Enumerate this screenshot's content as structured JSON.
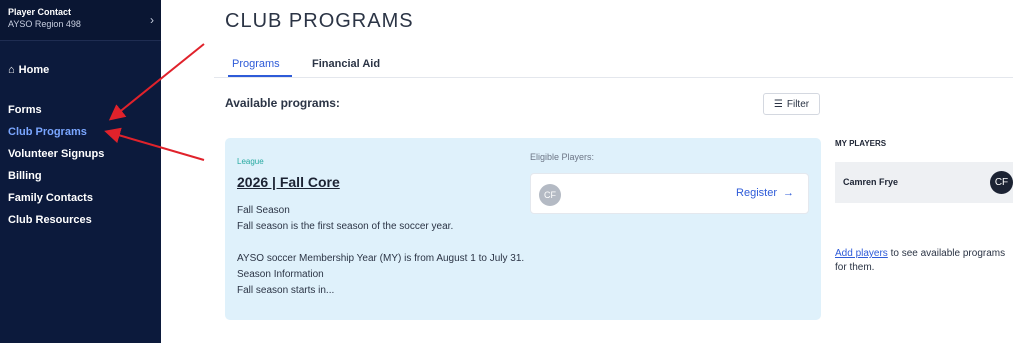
{
  "sidebar": {
    "org_label": "Player Contact",
    "org_region": "AYSO Region 498",
    "home_label": "Home",
    "items": [
      {
        "label": "Forms"
      },
      {
        "label": "Club Programs"
      },
      {
        "label": "Volunteer Signups"
      },
      {
        "label": "Billing"
      },
      {
        "label": "Family Contacts"
      },
      {
        "label": "Club Resources"
      }
    ],
    "active_index": 1
  },
  "main": {
    "title": "CLUB PROGRAMS",
    "tabs": [
      {
        "label": "Programs",
        "active": true
      },
      {
        "label": "Financial Aid",
        "active": false
      }
    ],
    "available_label": "Available programs:",
    "filter_label": "Filter"
  },
  "program": {
    "kind": "League",
    "name": "2026 | Fall Core",
    "description": "Fall Season\nFall season is the first season of the soccer year.\n\nAYSO soccer Membership Year (MY) is from August 1 to July 31.\nSeason Information\nFall season starts in...",
    "eligible_label": "Eligible Players:",
    "player_initials": "CF",
    "register_label": "Register"
  },
  "my_players": {
    "title": "MY PLAYERS",
    "player_name": "Camren Frye",
    "player_initials": "CF",
    "add_link": "Add players",
    "add_text": " to see available programs for them."
  },
  "colors": {
    "sidebar_bg": "#0c1a3c",
    "accent": "#2e5bd8",
    "card_bg": "#dff1fb",
    "annotation_arrow": "#e0222b"
  }
}
